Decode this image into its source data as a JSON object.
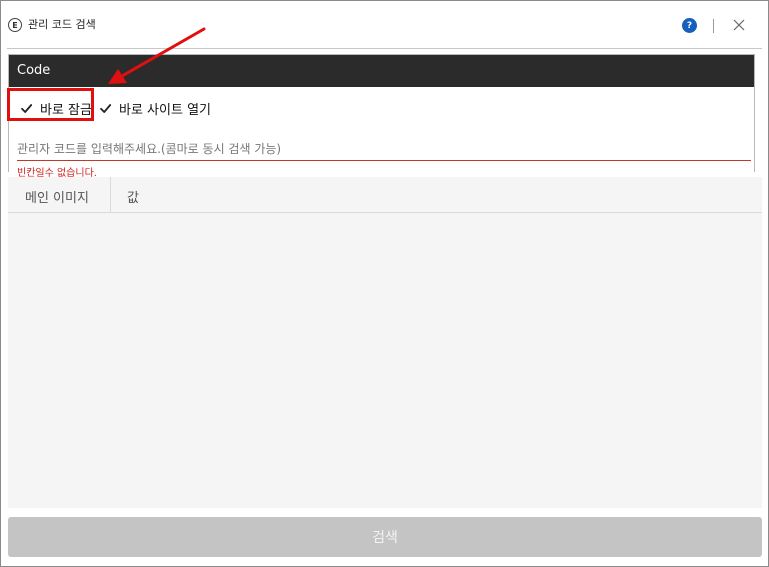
{
  "window": {
    "title": "관리 코드 검색",
    "app_icon_glyph": "E"
  },
  "titlebar": {
    "help_glyph": "?",
    "help_icon": "question-circle-icon",
    "close_icon": "close-icon"
  },
  "code_panel": {
    "header": "Code",
    "lock_checkbox": {
      "label": "바로 잠금",
      "checked": true
    },
    "open_checkbox": {
      "label": "바로 사이트 열기",
      "checked": true
    },
    "input_value": "",
    "input_placeholder": "관리자 코드를 입력해주세요.(콤마로 동시 검색 가능)",
    "error_message": "빈칸일수 없습니다."
  },
  "results": {
    "columns": [
      "메인 이미지",
      "값"
    ],
    "rows": []
  },
  "search_button": {
    "label": "검색"
  },
  "colors": {
    "header_bg": "#2b2b2b",
    "error": "#d02020",
    "annotation": "#e01010",
    "help_icon": "#1560bd",
    "button_disabled": "#c4c4c4"
  }
}
